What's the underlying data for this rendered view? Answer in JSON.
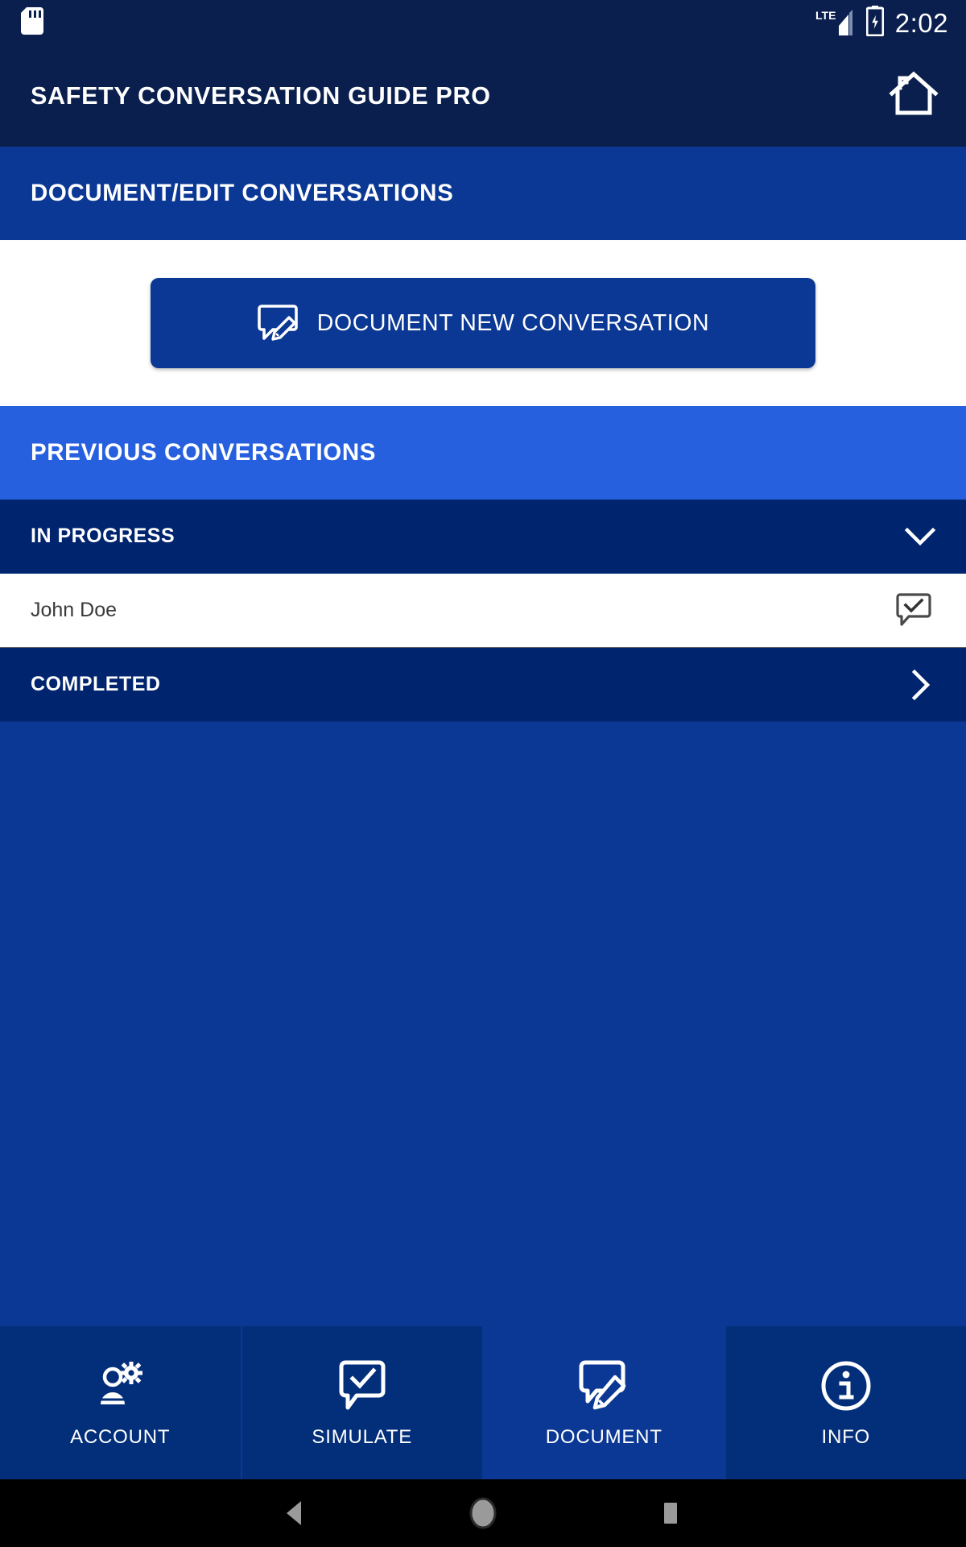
{
  "status_bar": {
    "sd_card_icon": "sd-card-icon",
    "network_label": "LTE",
    "signal_icon": "signal-bars-icon",
    "battery_icon": "battery-charging-icon",
    "time": "2:02"
  },
  "app_bar": {
    "title": "SAFETY CONVERSATION GUIDE PRO",
    "home_icon": "home-icon"
  },
  "sub_header": {
    "title": "DOCUMENT/EDIT CONVERSATIONS"
  },
  "action": {
    "primary_button_label": "DOCUMENT NEW CONVERSATION",
    "primary_button_icon": "comment-edit-icon"
  },
  "previous": {
    "banner_title": "PREVIOUS CONVERSATIONS",
    "groups": [
      {
        "label": "IN PROGRESS",
        "state": "expanded",
        "chevron_icon": "chevron-down-icon",
        "items": [
          {
            "name": "John Doe",
            "icon": "comment-check-icon"
          }
        ]
      },
      {
        "label": "COMPLETED",
        "state": "collapsed",
        "chevron_icon": "chevron-right-icon",
        "items": []
      }
    ]
  },
  "tab_bar": {
    "active": "DOCUMENT",
    "tabs": [
      {
        "label": "ACCOUNT",
        "icon": "person-gear-icon",
        "active": false
      },
      {
        "label": "SIMULATE",
        "icon": "comment-check-icon",
        "active": false
      },
      {
        "label": "DOCUMENT",
        "icon": "comment-edit-icon",
        "active": true
      },
      {
        "label": "INFO",
        "icon": "info-circle-icon",
        "active": false
      }
    ]
  },
  "system_nav": {
    "back_icon": "back-triangle-icon",
    "home_icon": "home-circle-icon",
    "recents_icon": "recents-square-icon"
  },
  "colors": {
    "navy_dark": "#0a1f4d",
    "blue_primary": "#0b3894",
    "blue_bright": "#2660df",
    "navy_group": "#00246e",
    "tab_inactive": "#032f7a",
    "white": "#ffffff",
    "row_text": "#3a3a3a",
    "icon_gray": "#4a4a4a"
  }
}
